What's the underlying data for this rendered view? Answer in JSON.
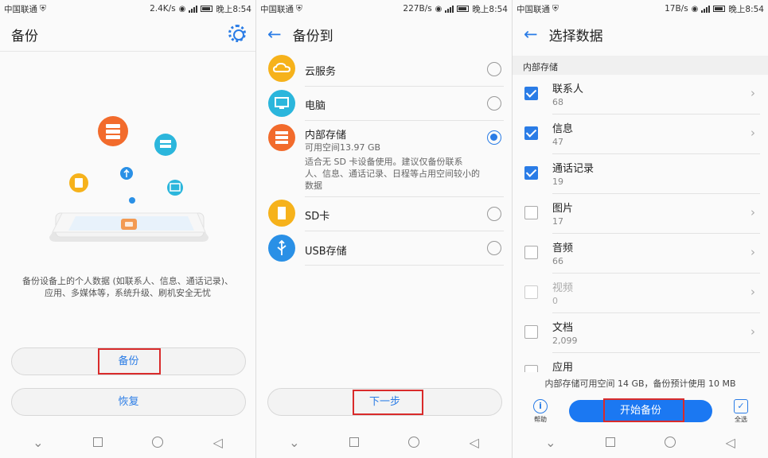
{
  "status_bars": [
    {
      "carrier": "中国联通",
      "speed": "2.4K/s",
      "time": "晚上8:54"
    },
    {
      "carrier": "中国联通",
      "speed": "227B/s",
      "time": "晚上8:54"
    },
    {
      "carrier": "中国联通",
      "speed": "17B/s",
      "time": "晚上8:54"
    }
  ],
  "backup_screen": {
    "title": "备份",
    "description_line1": "备份设备上的个人数据 (如联系人、信息、通话记录)、",
    "description_line2": "应用、多媒体等，系统升级、刷机安全无忧",
    "backup_button": "备份",
    "restore_button": "恢复"
  },
  "backup_to_screen": {
    "title": "备份到",
    "options": [
      {
        "label": "云服务",
        "icon": "cloud-icon",
        "color": "#f6b21b",
        "selected": false
      },
      {
        "label": "电脑",
        "icon": "monitor-icon",
        "color": "#2bb6dc",
        "selected": false
      },
      {
        "label": "内部存储",
        "icon": "storage-icon",
        "color": "#f26b2c",
        "selected": true,
        "available": "可用空间13.97 GB",
        "note": "适合无 SD 卡设备使用。建议仅备份联系人、信息、通话记录、日程等占用空间较小的数据"
      },
      {
        "label": "SD卡",
        "icon": "sd-card-icon",
        "color": "#f6b21b",
        "selected": false
      },
      {
        "label": "USB存储",
        "icon": "usb-icon",
        "color": "#2a90e6",
        "selected": false
      }
    ],
    "next_button": "下一步"
  },
  "select_data_screen": {
    "title": "选择数据",
    "section": "内部存储",
    "items": [
      {
        "name": "联系人",
        "count": "68",
        "checked": true,
        "disabled": false
      },
      {
        "name": "信息",
        "count": "47",
        "checked": true,
        "disabled": false
      },
      {
        "name": "通话记录",
        "count": "19",
        "checked": true,
        "disabled": false
      },
      {
        "name": "图片",
        "count": "17",
        "checked": false,
        "disabled": false
      },
      {
        "name": "音频",
        "count": "66",
        "checked": false,
        "disabled": false
      },
      {
        "name": "视频",
        "count": "0",
        "checked": false,
        "disabled": true
      },
      {
        "name": "文档",
        "count": "2,099",
        "checked": false,
        "disabled": false
      },
      {
        "name": "应用",
        "count": "",
        "checked": false,
        "disabled": false
      }
    ],
    "footnote": "内部存储可用空间 14 GB，备份预计使用 10 MB",
    "start_button": "开始备份",
    "help_label": "帮助",
    "select_all_label": "全选"
  },
  "colors": {
    "accent": "#2a7ce6",
    "primary_button": "#1b78f2",
    "highlight_box": "#d92b2b"
  }
}
